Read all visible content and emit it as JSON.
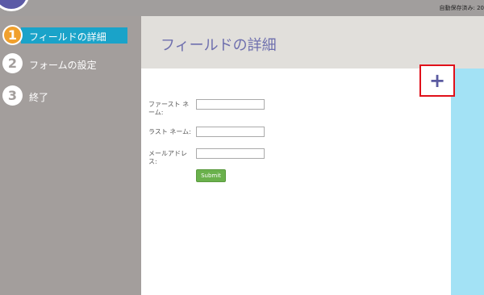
{
  "topbar": {
    "autosave_text": "自動保存済み: 20"
  },
  "sidebar": {
    "steps": [
      {
        "number": "1",
        "label": "フィールドの詳細"
      },
      {
        "number": "2",
        "label": "フォームの設定"
      },
      {
        "number": "3",
        "label": "終了"
      }
    ]
  },
  "header": {
    "title": "フィールドの詳細"
  },
  "toolbar": {
    "add_label": "+"
  },
  "form": {
    "fields": [
      {
        "label": "ファースト ネーム:",
        "value": ""
      },
      {
        "label": "ラスト ネーム:",
        "value": ""
      },
      {
        "label": "メールアドレス:",
        "value": ""
      }
    ],
    "submit_label": "Submit"
  },
  "colors": {
    "sidebar_bg": "#a39e9c",
    "active_step_bg": "#1aa3c9",
    "active_step_num": "#f0a02d",
    "title_color": "#6e6fae",
    "submit_bg": "#6ab14c",
    "highlight_border": "#e0101a",
    "right_panel": "#a3e2f5"
  }
}
